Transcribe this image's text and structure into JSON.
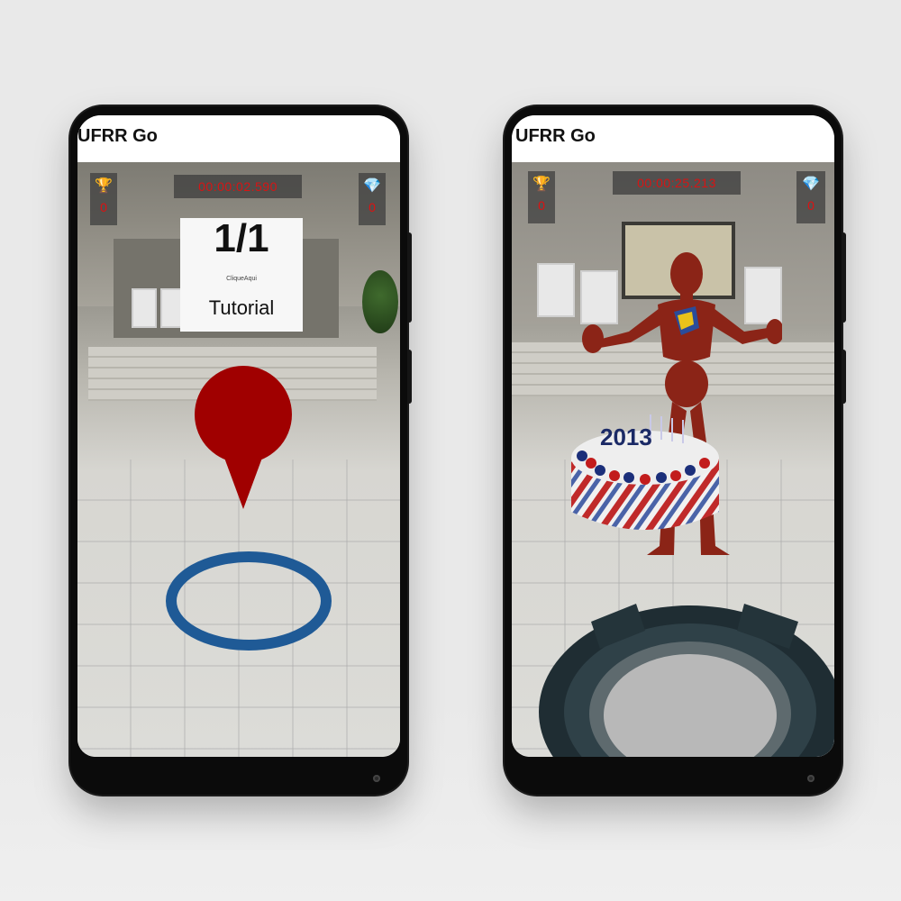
{
  "phones": [
    {
      "app_title": "UFRR Go",
      "timer": "00:00:02.590",
      "trophy_count": "0",
      "diamond_count": "0",
      "panel": {
        "count": "1/1",
        "hint": "CliqueAqui",
        "label": "Tutorial"
      },
      "marker_color": "#a00000",
      "ring_color": "#1f5a96"
    },
    {
      "app_title": "UFRR Go",
      "timer": "00:00:25.213",
      "trophy_count": "0",
      "diamond_count": "0",
      "cake_text": "2013"
    }
  ],
  "icons": {
    "trophy": "trophy-icon",
    "diamond": "diamond-icon"
  }
}
